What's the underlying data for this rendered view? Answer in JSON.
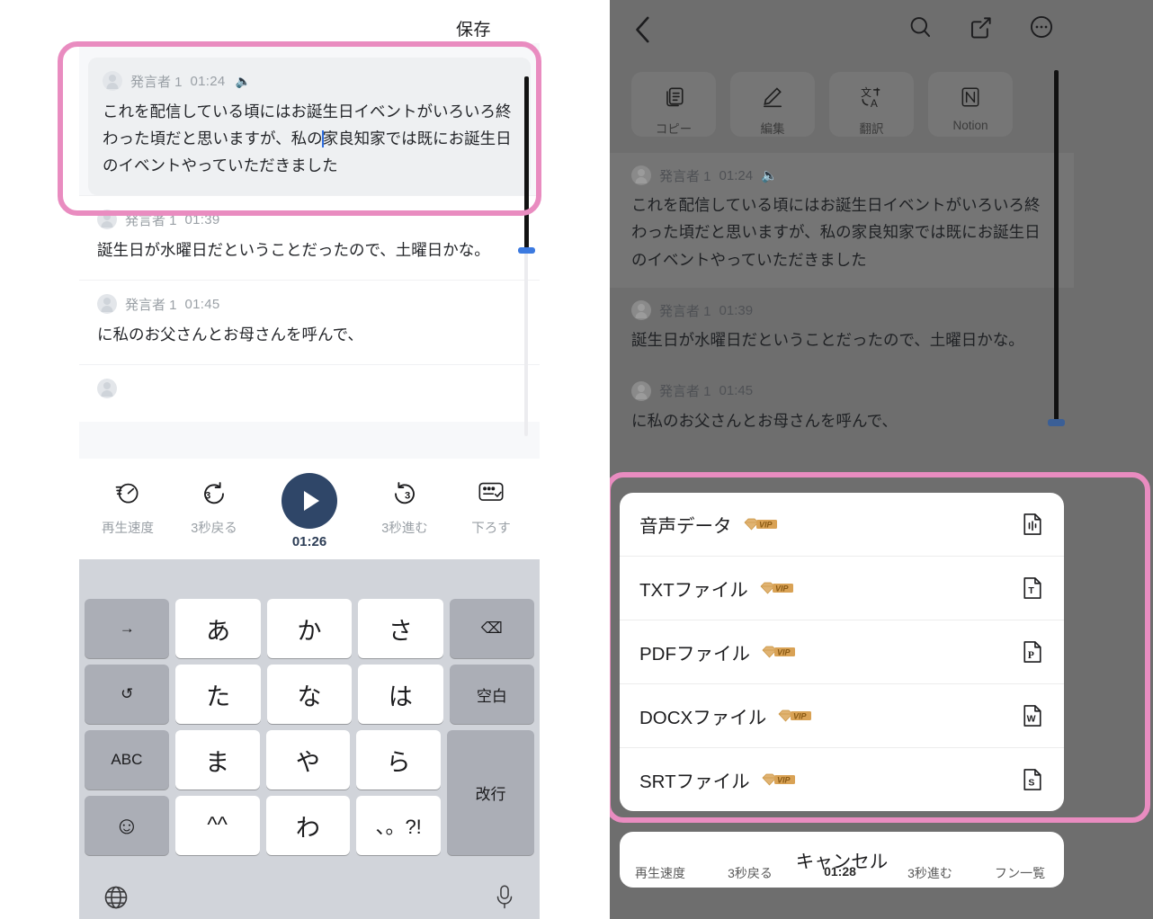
{
  "left": {
    "save_label": "保存",
    "transcript": [
      {
        "speaker": "発言者 1",
        "time": "01:24",
        "has_audio_icon": true,
        "text_pre": "これを配信している頃にはお誕生日イベントがいろいろ終わった頃だと思いますが、私の",
        "text_post": "家良知家では既にお誕生日のイベントやっていただきました",
        "selected": true
      },
      {
        "speaker": "発言者 1",
        "time": "01:39",
        "has_audio_icon": false,
        "text": "誕生日が水曜日だということだったので、土曜日かな。",
        "selected": false
      },
      {
        "speaker": "発言者 1",
        "time": "01:45",
        "has_audio_icon": false,
        "text": "に私のお父さんとお母さんを呼んで、",
        "selected": false
      }
    ],
    "player": {
      "speed_label": "再生速度",
      "back3_label": "3秒戻る",
      "time": "01:26",
      "fwd3_label": "3秒進む",
      "collapse_label": "下ろす"
    },
    "keyboard": {
      "rows": [
        [
          {
            "k": "→",
            "t": "g"
          },
          {
            "k": "あ",
            "t": "w"
          },
          {
            "k": "か",
            "t": "w"
          },
          {
            "k": "さ",
            "t": "w"
          },
          {
            "k": "⌫",
            "t": "g"
          }
        ],
        [
          {
            "k": "↺",
            "t": "g"
          },
          {
            "k": "た",
            "t": "w"
          },
          {
            "k": "な",
            "t": "w"
          },
          {
            "k": "は",
            "t": "w"
          },
          {
            "k": "空白",
            "t": "g"
          }
        ],
        [
          {
            "k": "ABC",
            "t": "g"
          },
          {
            "k": "ま",
            "t": "w"
          },
          {
            "k": "や",
            "t": "w"
          },
          {
            "k": "ら",
            "t": "w"
          },
          {
            "k": "改行",
            "t": "g"
          }
        ],
        [
          {
            "k": "☺",
            "t": "g"
          },
          {
            "k": "^^",
            "t": "w"
          },
          {
            "k": "わ",
            "t": "w"
          },
          {
            "k": "、。?!",
            "t": "w"
          }
        ]
      ],
      "globe_icon": "globe-icon",
      "mic_icon": "microphone-icon"
    }
  },
  "right": {
    "nav": {
      "back_icon": "chevron-left-icon",
      "search_icon": "search-icon",
      "edit_icon": "compose-icon",
      "more_icon": "more-circle-icon"
    },
    "tools": [
      {
        "label": "コピー",
        "icon": "copy-icon"
      },
      {
        "label": "編集",
        "icon": "pencil-icon"
      },
      {
        "label": "翻訳",
        "icon": "translate-icon"
      },
      {
        "label": "Notion",
        "icon": "notion-icon"
      }
    ],
    "transcript": [
      {
        "speaker": "発言者 1",
        "time": "01:24",
        "has_audio_icon": true,
        "text": "これを配信している頃にはお誕生日イベントがいろいろ終わった頃だと思いますが、私の家良知家では既にお誕生日のイベントやっていただきました"
      },
      {
        "speaker": "発言者 1",
        "time": "01:39",
        "has_audio_icon": false,
        "text": "誕生日が水曜日だということだったので、土曜日かな。"
      },
      {
        "speaker": "発言者 1",
        "time": "01:45",
        "has_audio_icon": false,
        "text": "に私のお父さんとお母さんを呼んで、"
      }
    ],
    "sheet": {
      "rows": [
        {
          "label": "音声データ",
          "vip": true,
          "icon": "audio-file-icon"
        },
        {
          "label": "TXTファイル",
          "vip": true,
          "icon": "txt-file-icon"
        },
        {
          "label": "PDFファイル",
          "vip": true,
          "icon": "pdf-file-icon"
        },
        {
          "label": "DOCXファイル",
          "vip": true,
          "icon": "docx-file-icon"
        },
        {
          "label": "SRTファイル",
          "vip": true,
          "icon": "srt-file-icon"
        }
      ],
      "vip_badge_text": "VIP",
      "cancel_label": "キャンセル"
    },
    "player_peek": {
      "speed_label": "再生速度",
      "back3_label": "3秒戻る",
      "time": "01:28",
      "fwd3_label": "3秒進む",
      "list_label": "フン一覧"
    }
  },
  "annotations": {
    "highlight_color": "#e98cc0",
    "left_target": "selected-transcript-block",
    "right_target": "export-action-sheet"
  },
  "colors": {
    "play_button": "#2f4668",
    "caret": "#2f6fe0",
    "scroll_knob": "#3c7ae0",
    "vip_gold": "#d99a3f",
    "overlay_dim": "#6e6e6e"
  }
}
